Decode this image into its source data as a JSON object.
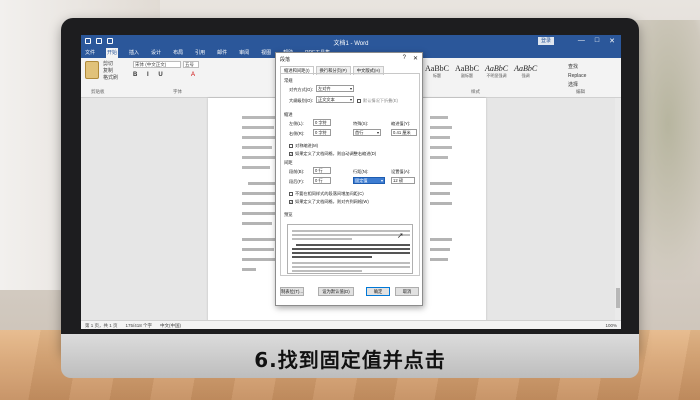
{
  "caption": "6.找到固定值并点击",
  "window": {
    "title": "文档1 - Word",
    "login": "登录",
    "controls": [
      "—",
      "□",
      "✕"
    ]
  },
  "ribbon_tabs": [
    "文件",
    "开始",
    "插入",
    "设计",
    "布局",
    "引用",
    "邮件",
    "审阅",
    "视图",
    "帮助",
    "PDF工具集"
  ],
  "active_tab": "开始",
  "ribbon": {
    "clipboard_label": "剪贴板",
    "font_label": "字体",
    "paragraph_label": "段落",
    "styles_label": "样式",
    "editing_label": "编辑",
    "font_name": "宋体 (中文正文)",
    "font_size": "五号",
    "cut": "剪切",
    "copy": "复制",
    "format_painter": "格式刷",
    "styles": [
      {
        "sample": "AaBbC",
        "name": "标题"
      },
      {
        "sample": "AaBbC",
        "name": "副标题"
      },
      {
        "sample": "AaBbC",
        "name": "不明显强调"
      },
      {
        "sample": "AaBbC",
        "name": "强调"
      }
    ],
    "editing": [
      "查找",
      "Replace",
      "选择"
    ]
  },
  "dialog": {
    "title": "段落",
    "tabs": [
      "缩进和间距(I)",
      "换行和分页(P)",
      "中文版式(H)"
    ],
    "active_tab": "缩进和间距(I)",
    "general_label": "常规",
    "alignment_label": "对齐方式(G):",
    "alignment_value": "左对齐",
    "outline_label": "大纲级别(O):",
    "outline_value": "正文文本",
    "collapse_label": "默认情况下折叠(E)",
    "indent_label": "缩进",
    "left_label": "左侧(L):",
    "left_value": "0 字符",
    "right_label": "右侧(R):",
    "right_value": "0 字符",
    "special_label": "特殊(S):",
    "special_value": "首行",
    "indent_by_label": "缩进值(Y):",
    "indent_by_value": "0.41 厘米",
    "mirror_label": "对称缩进(M)",
    "grid_indent_label": "如果定义了文档网格，则自动调整右缩进(D)",
    "spacing_label": "间距",
    "before_label": "段前(B):",
    "before_value": "0 行",
    "after_label": "段后(F):",
    "after_value": "0 行",
    "line_spacing_label": "行距(N):",
    "line_spacing_value": "固定值",
    "at_label": "设置值(A):",
    "at_value": "12 磅",
    "no_space_label": "不要在相同样式的段落间增加间距(C)",
    "snap_grid_label": "如果定义了文档网格，则对齐到网格(W)",
    "preview_label": "预览",
    "tabs_button": "制表位(T)...",
    "default_button": "设为默认值(D)",
    "ok_button": "确定",
    "cancel_button": "取消"
  },
  "status": {
    "page": "第 1 页，共 1 页",
    "words": "175/418 个字",
    "lang": "中文(中国)",
    "zoom": "100%"
  }
}
